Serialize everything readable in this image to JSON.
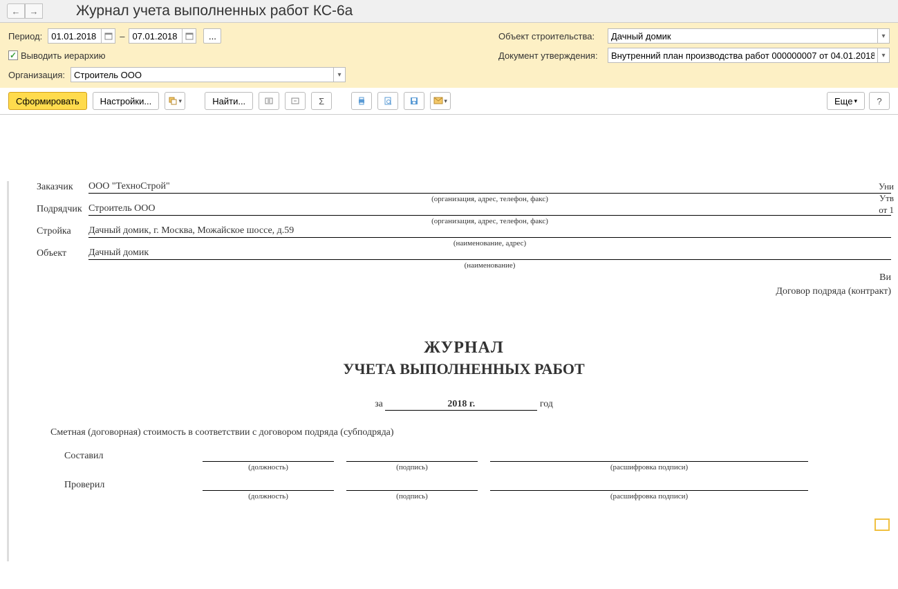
{
  "header": {
    "title": "Журнал учета выполненных работ КС-6а"
  },
  "filters": {
    "period_label": "Период:",
    "date_from": "01.01.2018",
    "date_to": "07.01.2018",
    "more": "...",
    "hierarchy_label": "Выводить иерархию",
    "organization_label": "Организация:",
    "organization_value": "Строитель ООО",
    "object_label": "Объект строительства:",
    "object_value": "Дачный домик",
    "approval_label": "Документ утверждения:",
    "approval_value": "Внутренний план производства работ 000000007 от 04.01.2018 "
  },
  "toolbar": {
    "generate": "Сформировать",
    "settings": "Настройки...",
    "find": "Найти...",
    "more": "Еще",
    "help": "?"
  },
  "report": {
    "meta_line1": "Уни",
    "meta_line2": "Утв",
    "meta_line3": "от 1",
    "customer_label": "Заказчик",
    "customer_value": "ООО \"ТехноСтрой\"",
    "contractor_label": "Подрядчик",
    "contractor_value": "Строитель ООО",
    "site_label": "Стройка",
    "site_value": "Дачный домик, г. Москва, Можайское шоссе, д.59",
    "object_label": "Объект",
    "object_value": "Дачный домик",
    "hint_org": "(организация, адрес, телефон, факс)",
    "hint_name_addr": "(наименование, адрес)",
    "hint_name": "(наименование)",
    "right_note1": "Ви",
    "right_note2": "Договор подряда (контракт)",
    "title1": "ЖУРНАЛ",
    "title2": "УЧЕТА ВЫПОЛНЕННЫХ РАБОТ",
    "year_prefix": "за",
    "year_value": "2018 г.",
    "year_suffix": "год",
    "cost_line": "Сметная (договорная) стоимость в соответствии с договором подряда (субподряда)",
    "compiled_label": "Составил",
    "checked_label": "Проверил",
    "hint_position": "(должность)",
    "hint_signature": "(подпись)",
    "hint_decipher": "(расшифровка подписи)"
  }
}
